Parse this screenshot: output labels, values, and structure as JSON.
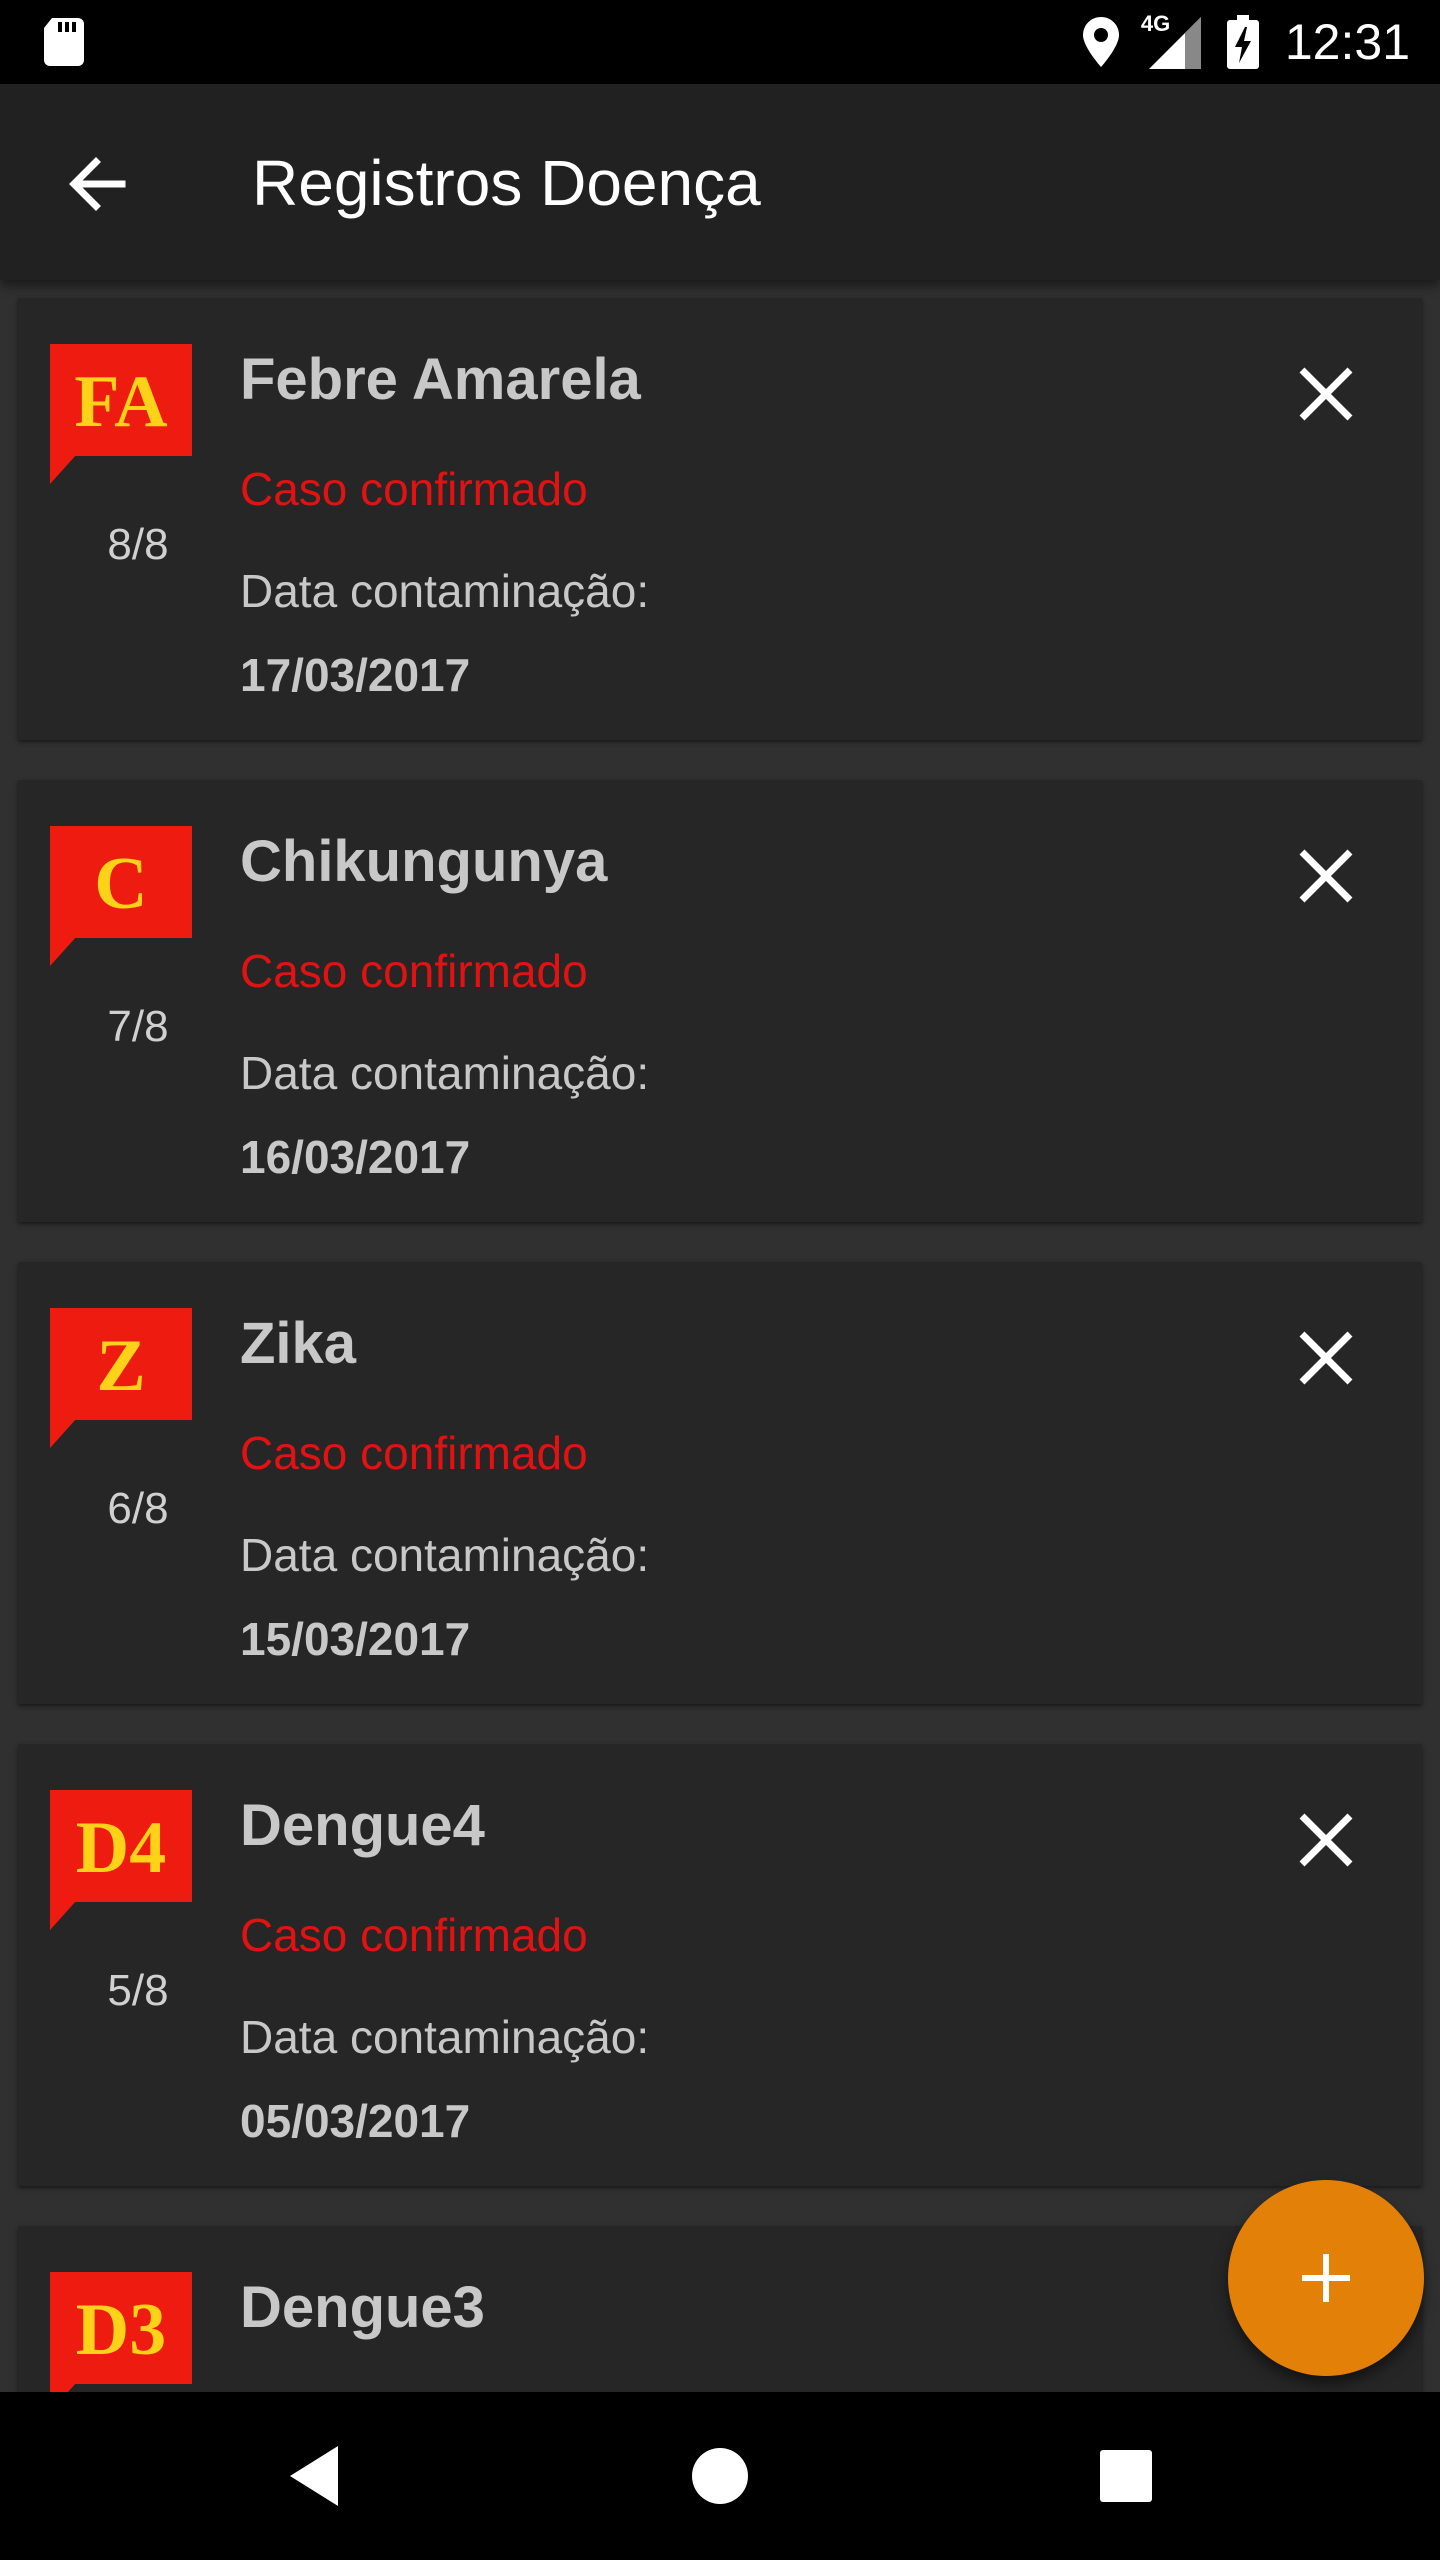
{
  "status_bar": {
    "time": "12:31",
    "network": "4G"
  },
  "app_bar": {
    "title": "Registros Doença"
  },
  "colors": {
    "status_confirmed": "#e01212",
    "badge_red": "#ee1c10",
    "badge_text": "#ffd21a",
    "fab": "#e38008"
  },
  "records": [
    {
      "badge": "FA",
      "counter": "8/8",
      "name": "Febre Amarela",
      "status": "Caso confirmado",
      "date_label": "Data contaminação:",
      "date": "17/03/2017"
    },
    {
      "badge": "C",
      "counter": "7/8",
      "name": "Chikungunya",
      "status": "Caso confirmado",
      "date_label": "Data contaminação:",
      "date": "16/03/2017"
    },
    {
      "badge": "Z",
      "counter": "6/8",
      "name": "Zika",
      "status": "Caso confirmado",
      "date_label": "Data contaminação:",
      "date": "15/03/2017"
    },
    {
      "badge": "D4",
      "counter": "5/8",
      "name": "Dengue4",
      "status": "Caso confirmado",
      "date_label": "Data contaminação:",
      "date": "05/03/2017"
    },
    {
      "badge": "D3",
      "counter": "",
      "name": "Dengue3",
      "status": "",
      "date_label": "",
      "date": ""
    }
  ],
  "icons": {
    "back": "arrow-back-icon",
    "remove": "close-icon",
    "add": "plus-icon",
    "nav_back": "triangle-back-icon",
    "nav_home": "circle-home-icon",
    "nav_recents": "square-recents-icon"
  }
}
